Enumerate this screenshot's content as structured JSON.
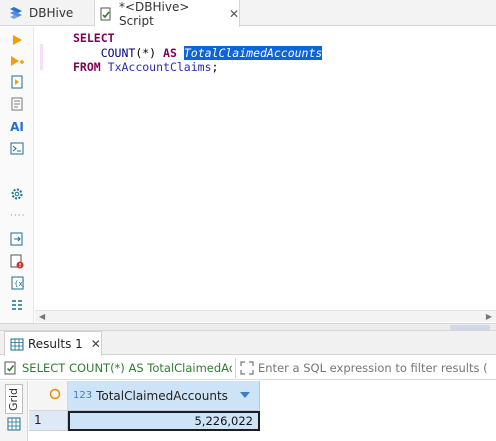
{
  "tabs": [
    {
      "label": "DBHive",
      "icon": "database-connection-icon"
    },
    {
      "label": "*<DBHive> Script",
      "icon": "sql-script-icon",
      "close": "✕"
    }
  ],
  "toolbar": {
    "icons": [
      "execute-statement-icon",
      "execute-in-new-tab-icon",
      "execute-script-icon",
      "explain-plan-icon",
      "ai-assist-icon",
      "open-console-icon",
      "settings-icon",
      "export-icon",
      "problems-icon",
      "variables-icon",
      "outline-icon"
    ]
  },
  "editor": {
    "line1_kw": "SELECT",
    "line2_fn": "COUNT",
    "line2_args": "(*)",
    "line2_as": "AS",
    "line2_alias": "TotalClaimedAccounts",
    "line3_kw": "FROM",
    "line3_table": "TxAccountClaims",
    "line3_end": ";"
  },
  "results": {
    "tab_label": "Results 1",
    "tab_close": "✕",
    "query_text": "SELECT COUNT(*) AS TotalClaimedAcco",
    "filter_placeholder": "Enter a SQL expression to filter results (use Ctrl+Space)",
    "mode_tab": "Grid",
    "column": {
      "type_label": "123",
      "name": "TotalClaimedAccounts"
    },
    "rows": [
      {
        "num": "1",
        "value": "5,226,022"
      }
    ]
  },
  "colors": {
    "keyword": "#7f0055",
    "selection": "#0b64d8",
    "query_text": "#2e7d32",
    "header_bg": "#cde3f7"
  }
}
